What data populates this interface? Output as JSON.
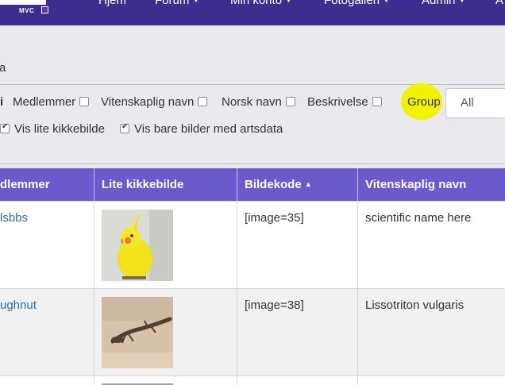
{
  "nav": {
    "logo_text": "MVC",
    "items": [
      {
        "label": "Hjem",
        "dropdown": false
      },
      {
        "label": "Forum",
        "dropdown": true
      },
      {
        "label": "Min konto",
        "dropdown": true
      },
      {
        "label": "Fotogalleri",
        "dropdown": true
      },
      {
        "label": "Admin",
        "dropdown": true
      },
      {
        "label": "A",
        "dropdown": false
      }
    ],
    "colors": {
      "bar": "#3d2d8e"
    }
  },
  "breadcrumb": {
    "text": "a"
  },
  "filters": {
    "prefix": "i",
    "items": [
      {
        "label": "Medlemmer",
        "checked": false
      },
      {
        "label": "Vitenskaplig navn",
        "checked": false
      },
      {
        "label": "Norsk navn",
        "checked": false
      },
      {
        "label": "Beskrivelse",
        "checked": false
      }
    ],
    "group_label": "Group",
    "group_value": "All"
  },
  "options": {
    "thumbnail_label": "Vis lite kikkebilde",
    "thumbnail_checked": true,
    "only_species_label": "Vis bare bilder med artsdata",
    "only_species_checked": true
  },
  "table": {
    "header_color": "#6b5acd",
    "columns": [
      "dlemmer",
      "Lite kikkebilde",
      "Bildekode",
      "Vitenskaplig navn"
    ],
    "sort_column": "Bildekode",
    "sort_direction": "ascending",
    "rows": [
      {
        "member": "lsbbs",
        "image": "cockatiel-photo",
        "code": "[image=35]",
        "scientific": "scientific name here"
      },
      {
        "member": "ughnut",
        "image": "newt-photo",
        "code": "[image=38]",
        "scientific": "Lissotriton vulgaris"
      }
    ]
  }
}
